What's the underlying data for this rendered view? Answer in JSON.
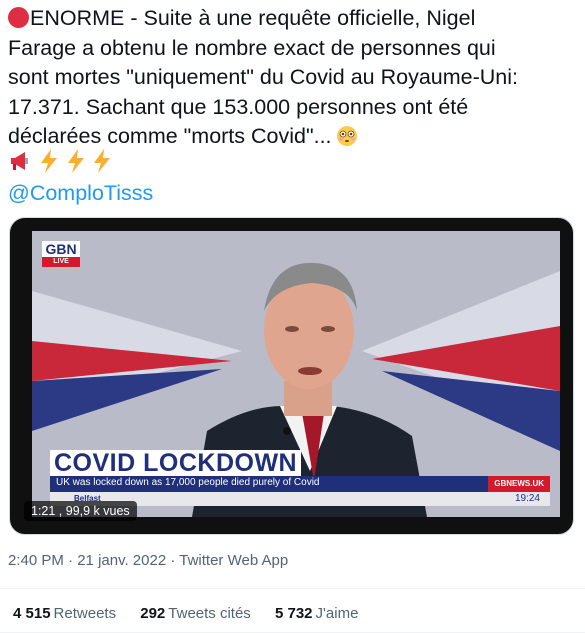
{
  "tweet": {
    "line1": "ENORME - Suite à une requête officielle, Nigel",
    "line2": "Farage a obtenu le nombre exact de personnes qui",
    "line3": "sont mortes \"uniquement\" du Covid au Royaume-Uni:",
    "line4": "17.371. Sachant que 153.000 personnes ont été",
    "line5": "déclarées comme \"morts Covid\"...",
    "handle": "@ComploTisss"
  },
  "video": {
    "channel_logo": "GBN",
    "live_label": "LIVE",
    "headline": "COVID LOCKDOWN",
    "subheadline": "UK was locked down as 17,000 people died purely of Covid",
    "site": "GBNEWS.UK",
    "location": "Belfast",
    "ticker_text": "...",
    "clock": "19:24",
    "views_badge": "1:21 , 99,9 k vues"
  },
  "meta": {
    "time": "2:40 PM",
    "separator1": " · ",
    "date": "21 janv. 2022",
    "separator2": " · ",
    "app": "Twitter Web App"
  },
  "stats": {
    "retweets_count": "4 515",
    "retweets_label": "Retweets",
    "quotes_count": "292",
    "quotes_label": "Tweets cités",
    "likes_count": "5 732",
    "likes_label": "J'aime"
  },
  "colors": {
    "accent": "#1d9bf0",
    "muted": "#536471",
    "text": "#0f1419",
    "gb_red": "#d31a2b",
    "gb_blue": "#1f2f7a"
  }
}
